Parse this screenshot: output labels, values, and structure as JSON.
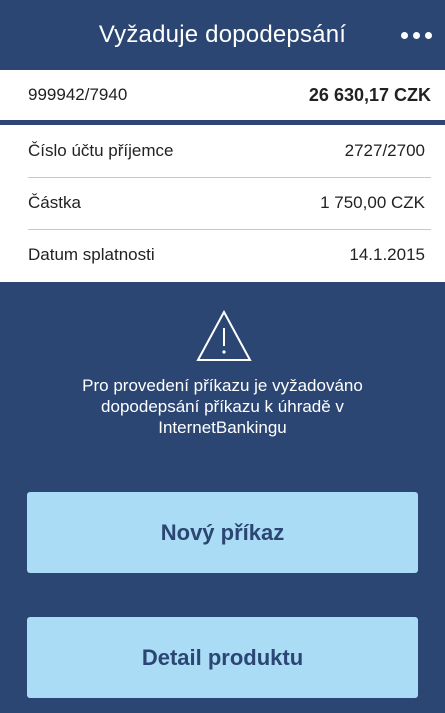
{
  "header": {
    "title": "Vyžaduje dopodepsání",
    "menu_icon": "more-dots-icon"
  },
  "account": {
    "number": "999942/7940",
    "balance": "26 630,17 CZK"
  },
  "details": [
    {
      "label": "Číslo účtu příjemce",
      "value": "2727/2700"
    },
    {
      "label": "Částka",
      "value": "1 750,00 CZK"
    },
    {
      "label": "Datum splatnosti",
      "value": "14.1.2015"
    }
  ],
  "warning": {
    "icon": "warning-triangle-icon",
    "text": "Pro provedení příkazu je vyžadováno dopodepsání příkazu k úhradě v InternetBankingu"
  },
  "buttons": {
    "new_order": "Nový příkaz",
    "product_detail": "Detail produktu"
  },
  "colors": {
    "header_bg": "#2b4672",
    "button_bg": "#aadcf5",
    "button_text": "#2b4672"
  }
}
